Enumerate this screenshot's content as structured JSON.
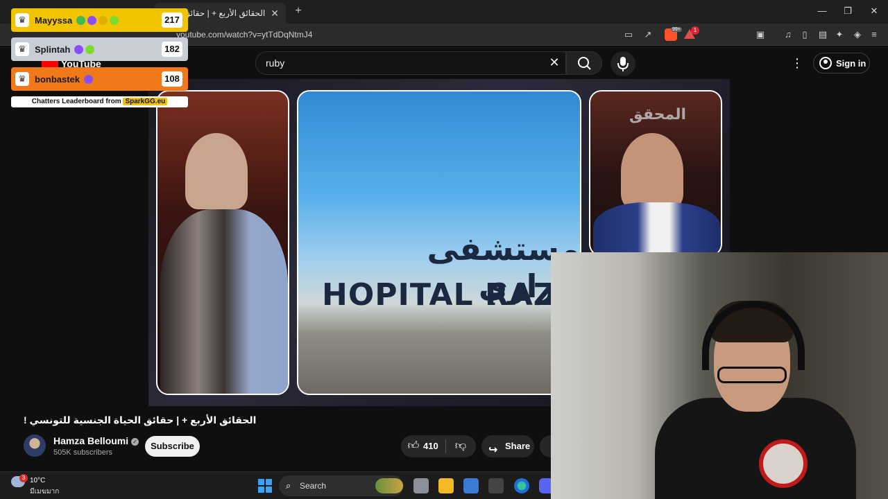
{
  "browser": {
    "tab_title": "الحقائق الأربع + | حقائق ال !",
    "tab_close": "✕",
    "new_tab": "+",
    "url": "youtube.com/watch?v=ytTdDqNtmJ4",
    "brave_badge": "99+",
    "rewards_badge": "1",
    "window_controls": [
      "—",
      "❐",
      "✕"
    ]
  },
  "youtube": {
    "logo_text": "YouTube",
    "search_value": "ruby",
    "sign_in": "Sign in"
  },
  "video": {
    "arabic_sign": "مستشفى الرازي",
    "hopital_sign": "HOPITAL RAZI",
    "watermark": "المحقق"
  },
  "info": {
    "title": "الحقائق الأربع + | حقائق الحياة الجنسية للتونسي !",
    "channel": "Hamza Belloumi",
    "subscribers": "505K subscribers",
    "subscribe": "Subscribe",
    "likes": "410",
    "share": "Share"
  },
  "leaderboard": {
    "entries": [
      {
        "name": "Mayyssa",
        "score": "217",
        "color": "#f2c400",
        "badges": [
          "#3dbb4f",
          "#8a4dff",
          "#e0b000",
          "#7bdc2e"
        ]
      },
      {
        "name": "Splintah",
        "score": "182",
        "color": "#c9ced6",
        "badges": [
          "#8a4dff",
          "#7bdc2e"
        ]
      },
      {
        "name": "bonbastek",
        "score": "108",
        "color": "#f07a1a",
        "badges": [
          "#8a4dff"
        ]
      }
    ],
    "footer_prefix": "Chatters Leaderboard from ",
    "footer_brand": "SparkGG.eu"
  },
  "taskbar": {
    "weather_badge": "3",
    "temperature": "10°C",
    "weather_desc": "มีเมฆมาก",
    "search": "Search"
  }
}
